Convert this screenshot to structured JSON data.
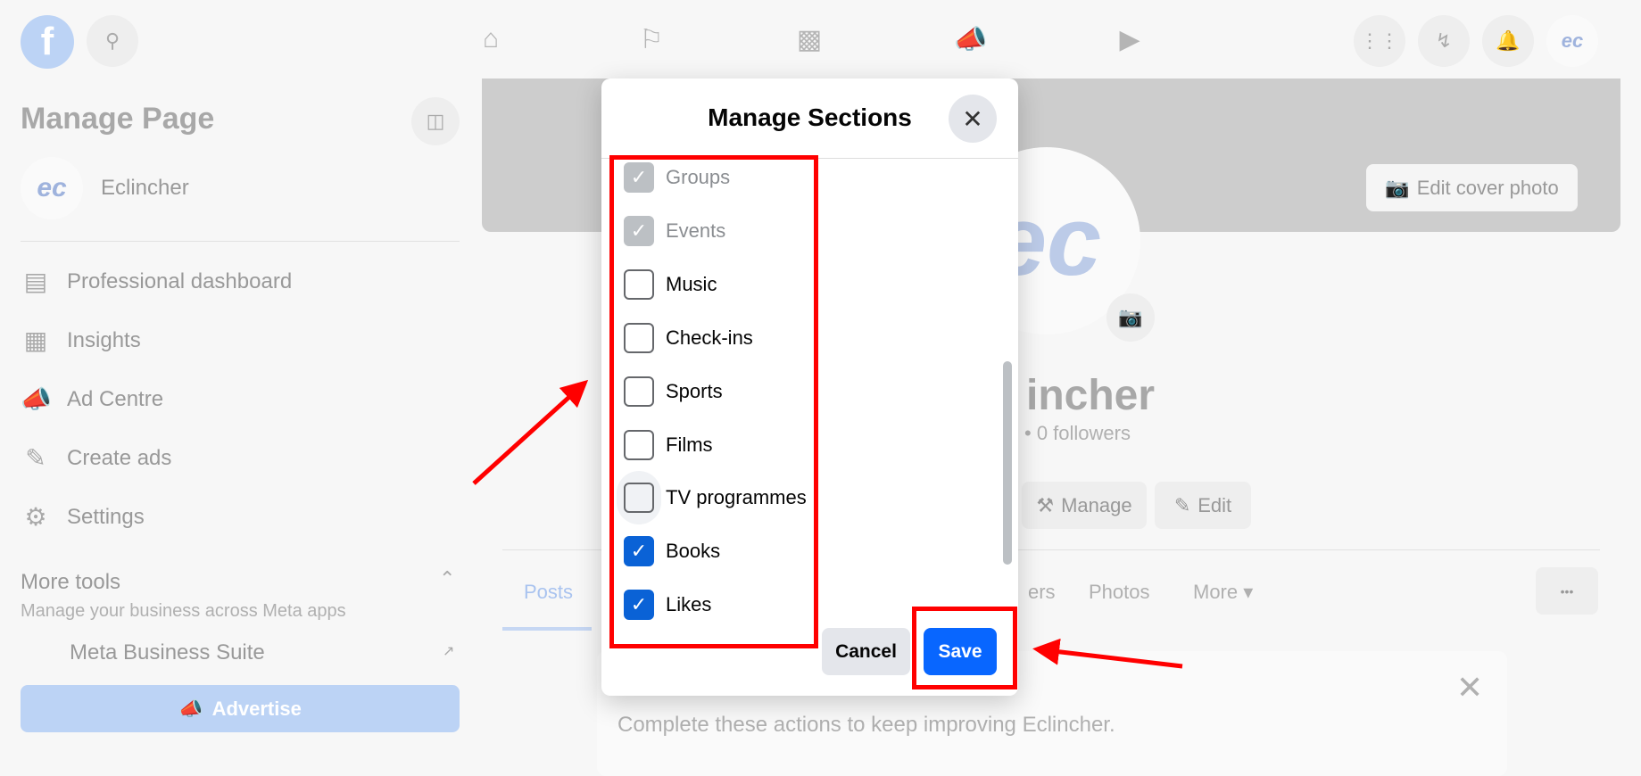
{
  "topbar": {
    "icons": [
      "facebook-logo",
      "search-icon",
      "home-icon",
      "flag-icon",
      "chart-icon",
      "megaphone-icon",
      "video-icon",
      "grid-icon",
      "messenger-icon",
      "bell-icon",
      "account-avatar"
    ]
  },
  "sidebar": {
    "title": "Manage Page",
    "page_name": "Eclincher",
    "items": [
      {
        "label": "Professional dashboard",
        "icon": "dashboard-icon"
      },
      {
        "label": "Insights",
        "icon": "insights-icon"
      },
      {
        "label": "Ad Centre",
        "icon": "megaphone-icon"
      },
      {
        "label": "Create ads",
        "icon": "pencil-icon"
      },
      {
        "label": "Settings",
        "icon": "gear-icon"
      }
    ],
    "more_tools": {
      "title": "More tools",
      "subtitle": "Manage your business across Meta apps",
      "item": "Meta Business Suite"
    },
    "advertise_label": "Advertise"
  },
  "main": {
    "edit_cover": "Edit cover photo",
    "page_name_partial": "incher",
    "followers": "• 0 followers",
    "manage_label": "Manage",
    "edit_label": "Edit",
    "tabs": [
      "Posts",
      "ers",
      "Photos",
      "More"
    ],
    "more_dots": "•••",
    "card_subtitle": "Complete these actions to keep improving Eclincher."
  },
  "modal": {
    "title": "Manage Sections",
    "items": [
      {
        "label": "Groups",
        "state": "checked-disabled"
      },
      {
        "label": "Events",
        "state": "checked-disabled"
      },
      {
        "label": "Music",
        "state": "unchecked"
      },
      {
        "label": "Check-ins",
        "state": "unchecked"
      },
      {
        "label": "Sports",
        "state": "unchecked"
      },
      {
        "label": "Films",
        "state": "unchecked"
      },
      {
        "label": "TV programmes",
        "state": "unchecked"
      },
      {
        "label": "Books",
        "state": "checked"
      },
      {
        "label": "Likes",
        "state": "checked"
      }
    ],
    "cancel_label": "Cancel",
    "save_label": "Save"
  },
  "colors": {
    "accent": "#0866ff",
    "annotation": "#ff0000",
    "checkbox": "#0a62d6"
  }
}
